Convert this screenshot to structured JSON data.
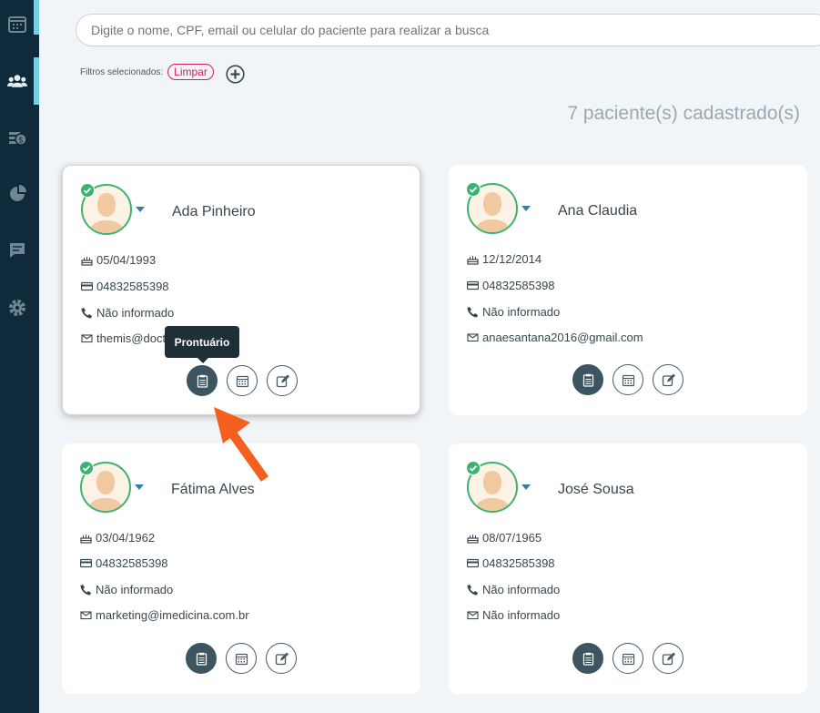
{
  "search": {
    "placeholder": "Digite o nome, CPF, email ou celular do paciente para realizar a busca"
  },
  "filters": {
    "label": "Filtros selecionados:",
    "clear": "Limpar"
  },
  "count": "7 paciente(s) cadastrado(s)",
  "tooltip": "Prontuário",
  "sidebar": [
    "calendar-icon",
    "patients-icon",
    "billing-icon",
    "reports-icon",
    "messages-icon",
    "settings-icon"
  ],
  "patients": [
    {
      "name": "Ada Pinheiro",
      "birth": "05/04/1993",
      "document": "04832585398",
      "phone": "Não informado",
      "email": "themis@doct"
    },
    {
      "name": "Ana Claudia",
      "birth": "12/12/2014",
      "document": "04832585398",
      "phone": "Não informado",
      "email": "anaesantana2016@gmail.com"
    },
    {
      "name": "Fátima Alves",
      "birth": "03/04/1962",
      "document": "04832585398",
      "phone": "Não informado",
      "email": "marketing@imedicina.com.br"
    },
    {
      "name": "José Sousa",
      "birth": "08/07/1965",
      "document": "04832585398",
      "phone": "Não informado",
      "email": "Não informado"
    }
  ],
  "colors": {
    "sidebar": "#0f2a3a",
    "accent": "#6fd3e8",
    "status": "#3cb371",
    "chip": "#d81b60",
    "arrow": "#f4601e"
  }
}
